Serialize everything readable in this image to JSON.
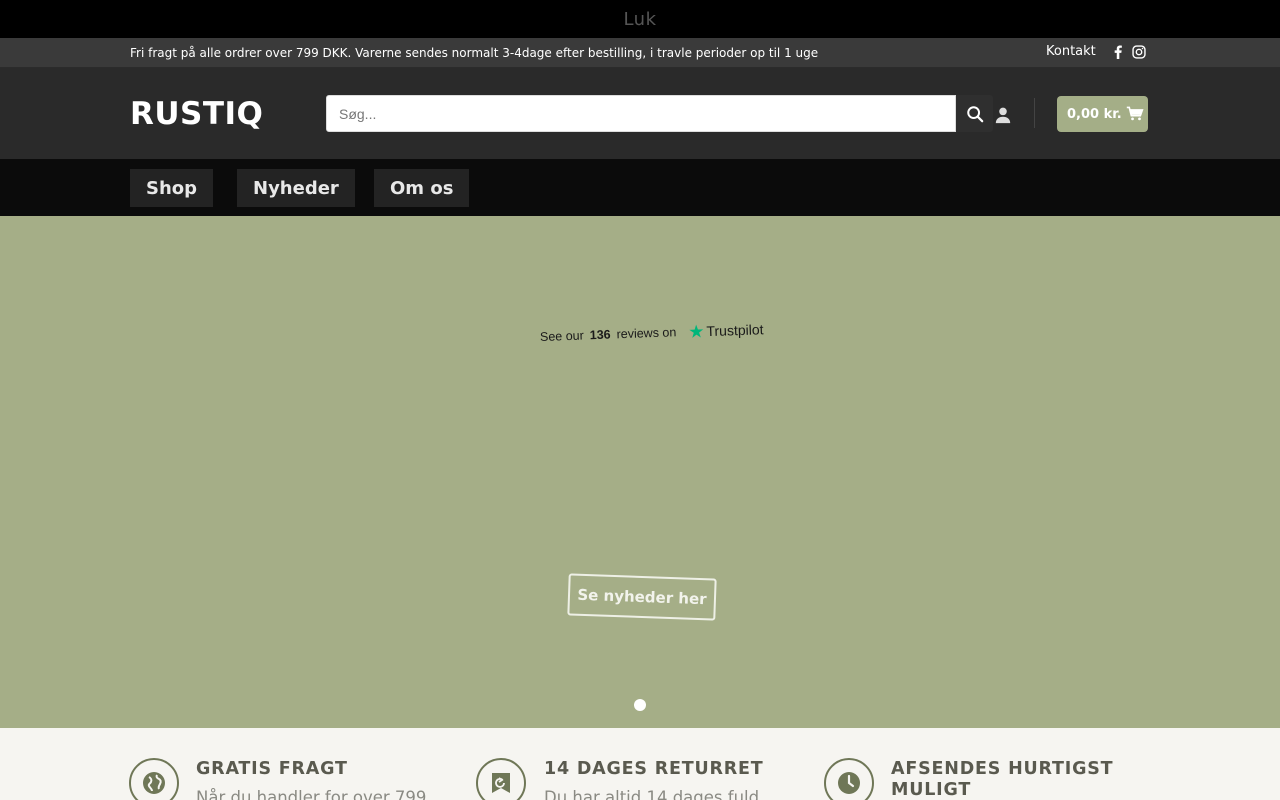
{
  "topbar": {
    "close_label": "Luk"
  },
  "infobar": {
    "message": "Fri fragt på alle ordrer over 799 DKK. Varerne sendes normalt 3-4dage efter bestilling, i travle perioder op til 1 uge",
    "contact_label": "Kontakt",
    "social": [
      "facebook-icon",
      "instagram-icon"
    ]
  },
  "header": {
    "logo": "RUSTIQ",
    "search_placeholder": "Søg...",
    "cart_label": "0,00 kr."
  },
  "nav": {
    "items": [
      "Shop",
      "Nyheder",
      "Om os"
    ]
  },
  "hero": {
    "trustpilot": {
      "prefix": "See our",
      "count": "136",
      "suffix": "reviews on",
      "brand": "Trustpilot"
    },
    "button_label": "Se nyheder her",
    "slides": 1,
    "active_slide": 1
  },
  "features": [
    {
      "icon": "globe-icon",
      "title": "GRATIS FRAGT",
      "description": "Når du handler for over 799"
    },
    {
      "icon": "return-icon",
      "title": "14 DAGES RETURRET",
      "description": "Du har altid 14 dages fuld"
    },
    {
      "icon": "clock-icon",
      "title": "AFSENDES HURTIGST",
      "title2": "MULIGT",
      "description": ""
    }
  ],
  "colors": {
    "accent": "#a4ae87",
    "hero_bg": "#a5ae87",
    "icon": "#6f7757"
  }
}
